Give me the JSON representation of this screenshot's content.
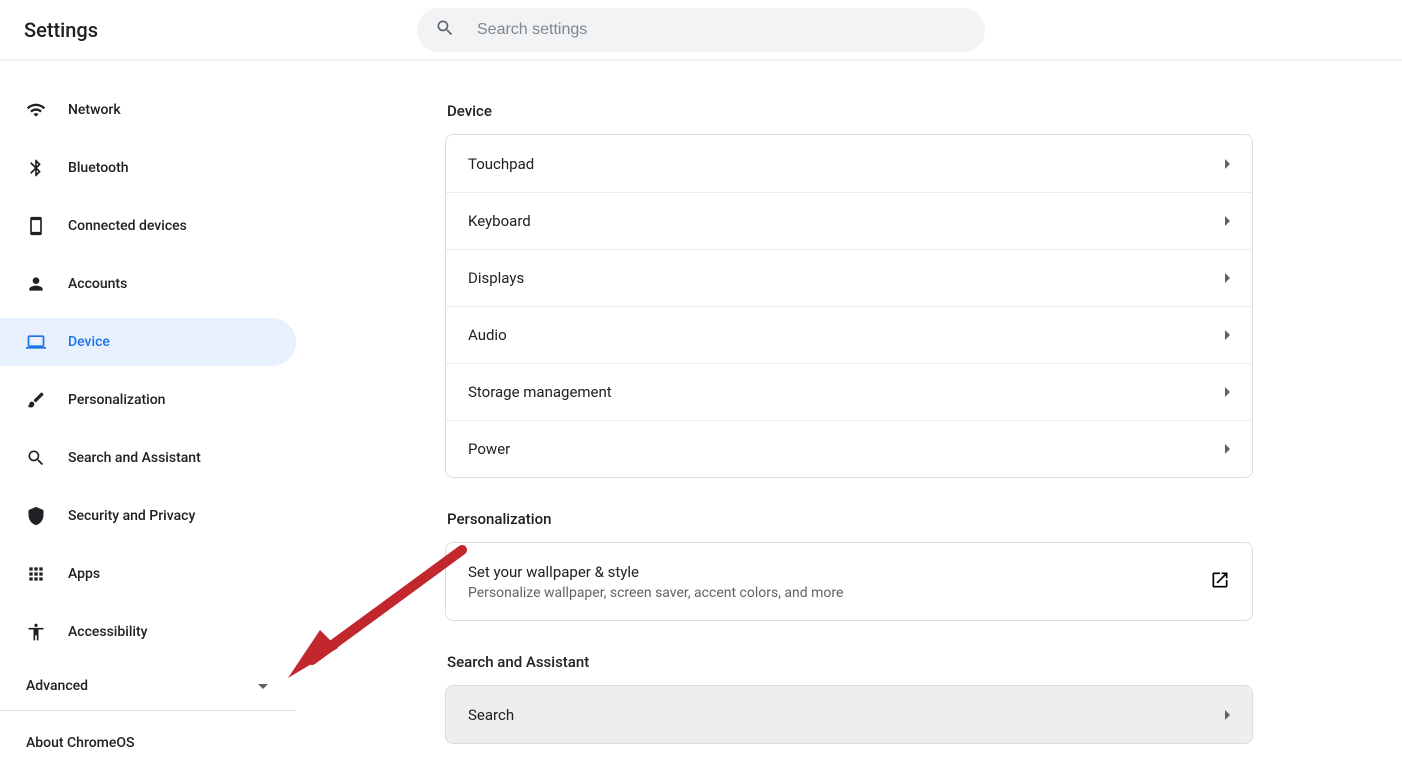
{
  "header": {
    "title": "Settings",
    "search_placeholder": "Search settings"
  },
  "sidebar": {
    "items": [
      {
        "icon": "network-wifi-icon",
        "label": "Network",
        "active": false
      },
      {
        "icon": "bluetooth-icon",
        "label": "Bluetooth",
        "active": false
      },
      {
        "icon": "devices-icon",
        "label": "Connected devices",
        "active": false
      },
      {
        "icon": "person-icon",
        "label": "Accounts",
        "active": false
      },
      {
        "icon": "laptop-icon",
        "label": "Device",
        "active": true
      },
      {
        "icon": "brush-icon",
        "label": "Personalization",
        "active": false
      },
      {
        "icon": "search-icon",
        "label": "Search and Assistant",
        "active": false
      },
      {
        "icon": "shield-icon",
        "label": "Security and Privacy",
        "active": false
      },
      {
        "icon": "apps-icon",
        "label": "Apps",
        "active": false
      },
      {
        "icon": "accessibility-icon",
        "label": "Accessibility",
        "active": false
      }
    ],
    "advanced_label": "Advanced",
    "about_label": "About ChromeOS"
  },
  "sections": {
    "device": {
      "title": "Device",
      "rows": [
        {
          "label": "Touchpad"
        },
        {
          "label": "Keyboard"
        },
        {
          "label": "Displays"
        },
        {
          "label": "Audio"
        },
        {
          "label": "Storage management"
        },
        {
          "label": "Power"
        }
      ]
    },
    "personalization": {
      "title": "Personalization",
      "row": {
        "primary": "Set your wallpaper & style",
        "secondary": "Personalize wallpaper, screen saver, accent colors, and more"
      }
    },
    "search_assistant": {
      "title": "Search and Assistant",
      "rows": [
        {
          "label": "Search",
          "hovered": true
        }
      ]
    }
  },
  "colors": {
    "accent": "#1a73e8",
    "accent_bg": "#e8f0fe",
    "text": "#202124",
    "muted": "#5f6368",
    "border": "#dadce0",
    "annotation": "#c1272d"
  }
}
